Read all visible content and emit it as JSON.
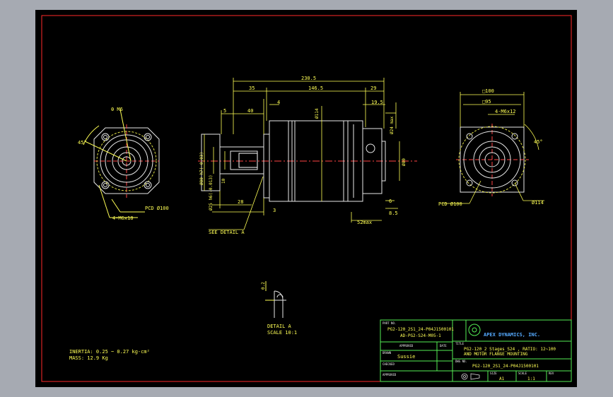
{
  "drawing": {
    "dimensions": {
      "overall_length": "230.5",
      "d35": "35",
      "d146": "146.5",
      "d29": "29",
      "d5": "5",
      "d40": "40",
      "d4": "4",
      "d114": "Ø114",
      "d19_5": "19.5",
      "d24": "Ø24 max",
      "d80h7": "Ø80 h7(-0.03)",
      "d25": "Ø25 h6(-0.013)",
      "d10": "10",
      "d28": "28",
      "d3": "3",
      "d6": "6",
      "d8_5": "8.5",
      "d52": "52max",
      "d80": "Ø80",
      "see_detail": "SEE DETAIL A",
      "left_m6": "θ M6",
      "left_45": "45°",
      "left_pcd": "PCD Ø100",
      "left_holes": "4-M6x18",
      "right_sq": "□100",
      "right_sq2": "□95",
      "right_holes": "4-M6x12",
      "right_45": "45°",
      "right_pcd": "PCD Ø100",
      "right_d114": "Ø114",
      "detail_dim": "0.2",
      "detail_title": "DETAIL A",
      "detail_scale": "SCALE 10:1"
    },
    "notes": {
      "inertia": "INERTIA: 0.25 ~ 0.27 kg-cm²",
      "mass": "MASS: 12.9 Kg"
    },
    "title_block": {
      "part_no_label": "PART NO.",
      "part_no_1": "PG2-120_2S1_24-P04J1500101",
      "part_no_2": "AD-PG2-S24-M05-1",
      "approved_label": "APPROVED",
      "date_label": "DATE",
      "drawn_label": "DRAWN",
      "drawn_by": "Sussie",
      "checked_label": "CHECKED",
      "approved2_label": "APPROVED",
      "company": "APEX DYNAMICS, INC.",
      "title_label": "TITLE",
      "title_1": "PG2-120_2 Stages_S24 , RATIO: 12~100",
      "title_2": "AND MOTOR FLANGE MOUNTING",
      "dwg_no_label": "DWG NO.",
      "dwg_no": "PG2-120_2S1_24-P04J1500101",
      "size_label": "SIZE",
      "size": "A1",
      "scale_label": "SCALE",
      "scale": "1:1",
      "rev_label": "REV"
    }
  }
}
